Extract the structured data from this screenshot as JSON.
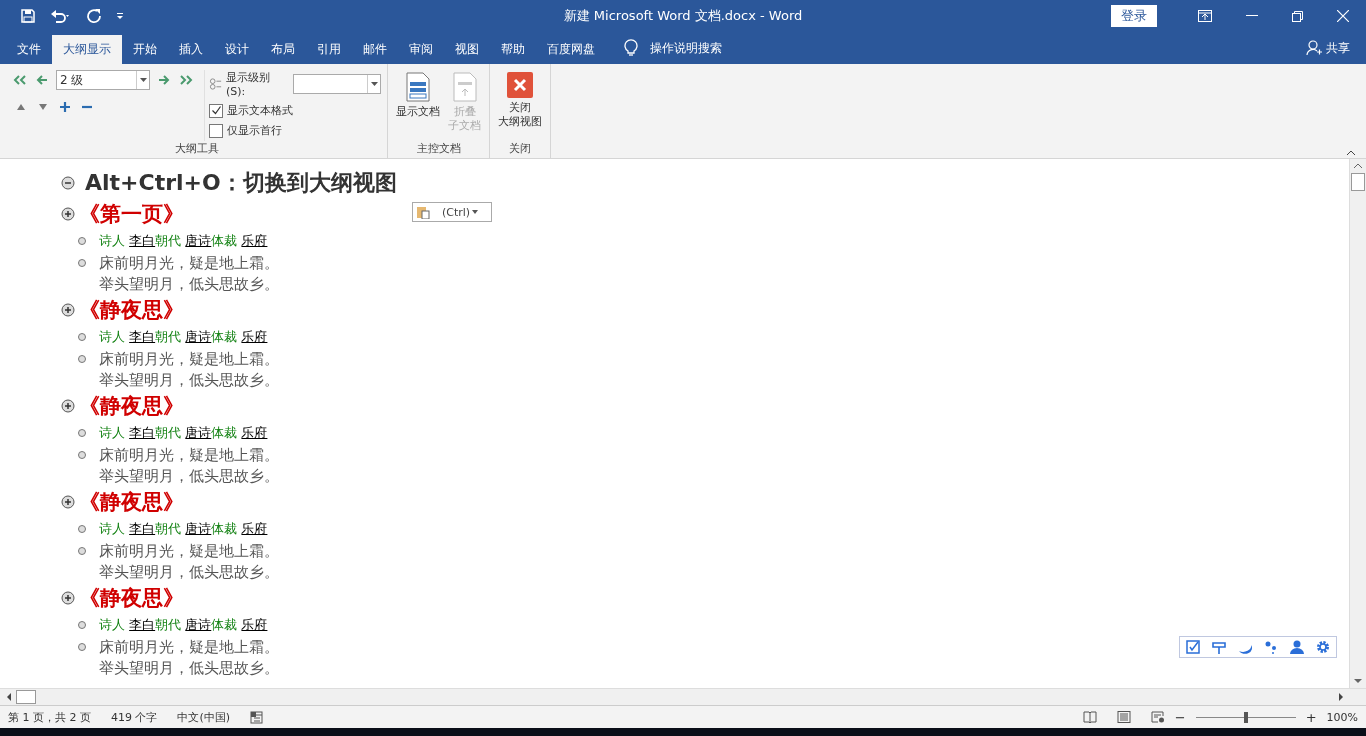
{
  "window": {
    "title": "新建 Microsoft Word 文档.docx  -  Word",
    "signin": "登录"
  },
  "tabs": [
    {
      "label": "文件",
      "selected": false
    },
    {
      "label": "大纲显示",
      "selected": true
    },
    {
      "label": "开始",
      "selected": false
    },
    {
      "label": "插入",
      "selected": false
    },
    {
      "label": "设计",
      "selected": false
    },
    {
      "label": "布局",
      "selected": false
    },
    {
      "label": "引用",
      "selected": false
    },
    {
      "label": "邮件",
      "selected": false
    },
    {
      "label": "审阅",
      "selected": false
    },
    {
      "label": "视图",
      "selected": false
    },
    {
      "label": "帮助",
      "selected": false
    },
    {
      "label": "百度网盘",
      "selected": false
    }
  ],
  "tell_me": "操作说明搜索",
  "share": "共享",
  "ribbon": {
    "level_value": "2 级",
    "show_level_label": "显示级别(S):",
    "checkboxes": [
      {
        "label": "显示文本格式",
        "checked": true
      },
      {
        "label": "仅显示首行",
        "checked": false
      }
    ],
    "group_outline": "大纲工具",
    "show_document": "显示文档",
    "collapse_sub": [
      "折叠",
      "子文档"
    ],
    "group_master": "主控文档",
    "close_outline": [
      "关闭",
      "大纲视图"
    ],
    "group_close": "关闭"
  },
  "document": {
    "heading": {
      "text": "Alt+Ctrl+O：切换到大纲视图",
      "expanded": true
    },
    "paste_options": "(Ctrl)",
    "sections": [
      {
        "title": "《第一页》",
        "meta": [
          {
            "kind": "label",
            "text": "诗人"
          },
          {
            "kind": "value",
            "text": "李白"
          },
          {
            "kind": "label",
            "text": "朝代"
          },
          {
            "kind": "value",
            "text": "唐诗"
          },
          {
            "kind": "label",
            "text": "体裁"
          },
          {
            "kind": "value",
            "text": "乐府"
          }
        ],
        "lines": [
          "床前明月光，疑是地上霜。",
          "举头望明月，低头思故乡。"
        ]
      },
      {
        "title": "《静夜思》",
        "meta": [
          {
            "kind": "label",
            "text": "诗人"
          },
          {
            "kind": "value",
            "text": "李白"
          },
          {
            "kind": "label",
            "text": "朝代"
          },
          {
            "kind": "value",
            "text": "唐诗"
          },
          {
            "kind": "label",
            "text": "体裁"
          },
          {
            "kind": "value",
            "text": "乐府"
          }
        ],
        "lines": [
          "床前明月光，疑是地上霜。",
          "举头望明月，低头思故乡。"
        ]
      },
      {
        "title": "《静夜思》",
        "meta": [
          {
            "kind": "label",
            "text": "诗人"
          },
          {
            "kind": "value",
            "text": "李白"
          },
          {
            "kind": "label",
            "text": "朝代"
          },
          {
            "kind": "value",
            "text": "唐诗"
          },
          {
            "kind": "label",
            "text": "体裁"
          },
          {
            "kind": "value",
            "text": "乐府"
          }
        ],
        "lines": [
          "床前明月光，疑是地上霜。",
          "举头望明月，低头思故乡。"
        ]
      },
      {
        "title": "《静夜思》",
        "meta": [
          {
            "kind": "label",
            "text": "诗人"
          },
          {
            "kind": "value",
            "text": "李白"
          },
          {
            "kind": "label",
            "text": "朝代"
          },
          {
            "kind": "value",
            "text": "唐诗"
          },
          {
            "kind": "label",
            "text": "体裁"
          },
          {
            "kind": "value",
            "text": "乐府"
          }
        ],
        "lines": [
          "床前明月光，疑是地上霜。",
          "举头望明月，低头思故乡。"
        ]
      },
      {
        "title": "《静夜思》",
        "meta": [
          {
            "kind": "label",
            "text": "诗人"
          },
          {
            "kind": "value",
            "text": "李白"
          },
          {
            "kind": "label",
            "text": "朝代"
          },
          {
            "kind": "value",
            "text": "唐诗"
          },
          {
            "kind": "label",
            "text": "体裁"
          },
          {
            "kind": "value",
            "text": "乐府"
          }
        ],
        "lines": [
          "床前明月光，疑是地上霜。",
          "举头望明月，低头思故乡。"
        ]
      }
    ]
  },
  "status_bar": {
    "page": "第 1 页，共 2 页",
    "words": "419 个字",
    "language": "中文(中国)",
    "zoom_out": "−",
    "zoom_in": "+",
    "zoom": "100%",
    "zoom_slider": {
      "level": 0.5
    }
  }
}
